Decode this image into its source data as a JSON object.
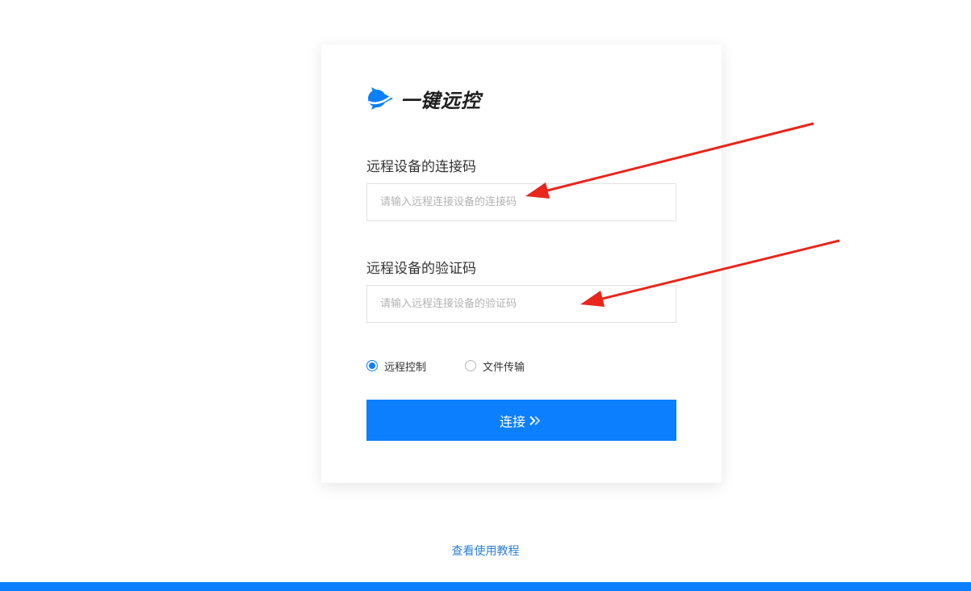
{
  "logo": {
    "text": "一键远控",
    "icon": "play-star-logo-icon"
  },
  "form": {
    "code_label": "远程设备的连接码",
    "code_placeholder": "请输入远程连接设备的连接码",
    "code_value": "",
    "verify_label": "远程设备的验证码",
    "verify_placeholder": "请输入远程连接设备的验证码",
    "verify_value": "",
    "mode_options": [
      {
        "label": "远程控制",
        "checked": true
      },
      {
        "label": "文件传输",
        "checked": false
      }
    ],
    "connect_label": "连接",
    "connect_icon": "double-chevron-right-icon"
  },
  "footer": {
    "tutorial_link": "查看使用教程"
  },
  "colors": {
    "accent": "#0b7ffe",
    "link": "#2a7fd6",
    "annotation_arrow": "#e8261c"
  }
}
